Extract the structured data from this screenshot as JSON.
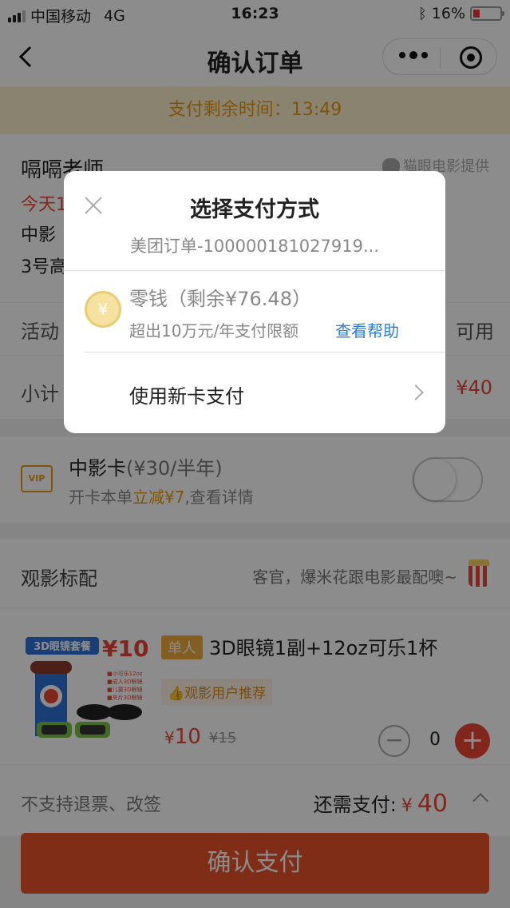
{
  "statusbar": {
    "carrier": "中国移动",
    "network": "4G",
    "time": "16:23",
    "battery": "16%"
  },
  "navbar": {
    "title": "确认订单"
  },
  "timer": {
    "label": "支付剩余时间：13:49"
  },
  "movie": {
    "title": "嗝嗝老师",
    "provider": "猫眼电影提供",
    "time_prefix": "今天1",
    "cinema_prefix": "中影",
    "hall_prefix": "3号高"
  },
  "activity": {
    "label": "活动",
    "value": "可用"
  },
  "subtotal": {
    "label": "小计",
    "value": "¥40"
  },
  "vip": {
    "icon_text": "VIP",
    "title": "中影卡",
    "title_price": "(¥30/半年)",
    "sub_prefix": "开卡本单",
    "sub_highlight": "立减¥7",
    "sub_suffix": ",查看详情"
  },
  "snack_section": {
    "label": "观影标配",
    "slogan": "客官，爆米花跟电影最配噢~"
  },
  "snack": {
    "image_caption": "3D眼镜套餐 ¥10",
    "tag": "单人",
    "name": "3D眼镜1副+12oz可乐1杯",
    "recommend": "观影用户推荐",
    "price_currency": "¥",
    "price": "10",
    "old_price": "¥15",
    "quantity": "0"
  },
  "bottom": {
    "note": "不支持退票、改签",
    "need_label": "还需支付:",
    "currency": "¥",
    "amount": "40"
  },
  "confirm_button": "确认支付",
  "dialog": {
    "title": "选择支付方式",
    "order": "美团订单-100000181027919...",
    "wallet_name": "零钱（剩余¥76.48）",
    "wallet_limit": "超出10万元/年支付限额",
    "wallet_help": "查看帮助",
    "new_card": "使用新卡支付",
    "coin_symbol": "¥"
  },
  "colors": {
    "accent_red": "#e94534",
    "timer_bg": "#fbeecb",
    "timer_text": "#e69a14",
    "link_blue": "#2a7fd4"
  }
}
